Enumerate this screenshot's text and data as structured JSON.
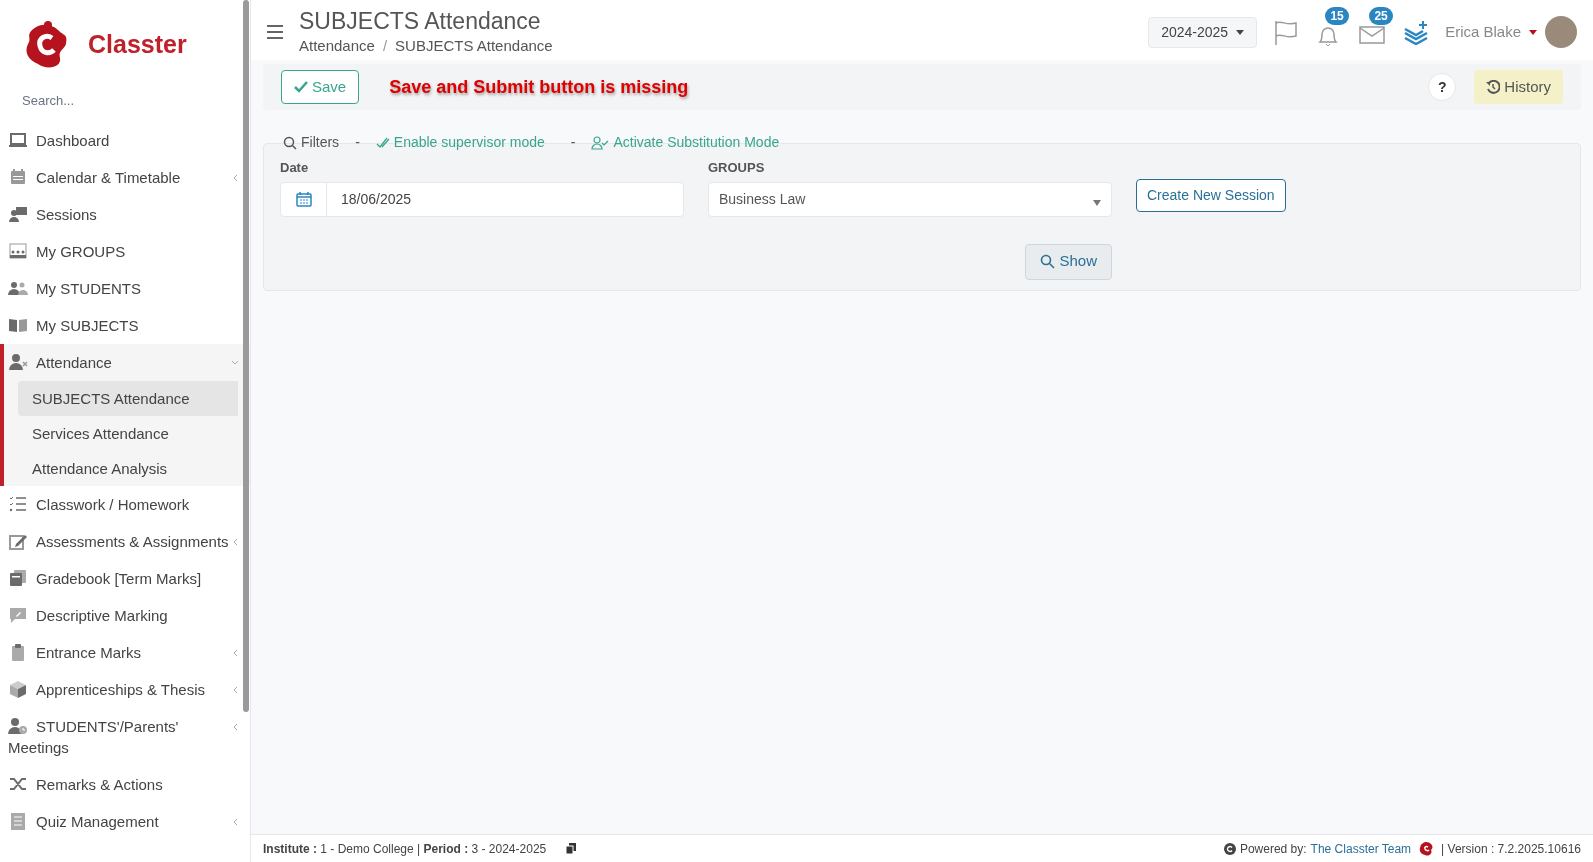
{
  "brand": {
    "name": "Classter"
  },
  "sidebar": {
    "search": {
      "placeholder": "Search..."
    },
    "items": [
      {
        "label": "Dashboard",
        "has_submenu": false,
        "expanded": false
      },
      {
        "label": "Calendar & Timetable",
        "has_submenu": true,
        "expanded": false
      },
      {
        "label": "Sessions",
        "has_submenu": false,
        "expanded": false
      },
      {
        "label": "My GROUPS",
        "has_submenu": false,
        "expanded": false
      },
      {
        "label": "My STUDENTS",
        "has_submenu": false,
        "expanded": false
      },
      {
        "label": "My SUBJECTS",
        "has_submenu": false,
        "expanded": false
      },
      {
        "label": "Attendance",
        "has_submenu": true,
        "expanded": true,
        "children": [
          {
            "label": "SUBJECTS Attendance",
            "selected": true
          },
          {
            "label": "Services Attendance",
            "selected": false
          },
          {
            "label": "Attendance Analysis",
            "selected": false
          }
        ]
      },
      {
        "label": "Classwork / Homework",
        "has_submenu": false,
        "expanded": false
      },
      {
        "label": "Assessments & Assignments",
        "has_submenu": true,
        "expanded": false
      },
      {
        "label": "Gradebook [Term Marks]",
        "has_submenu": false,
        "expanded": false
      },
      {
        "label": "Descriptive Marking",
        "has_submenu": false,
        "expanded": false
      },
      {
        "label": "Entrance Marks",
        "has_submenu": true,
        "expanded": false
      },
      {
        "label": "Apprenticeships & Thesis",
        "has_submenu": true,
        "expanded": false
      },
      {
        "label": "STUDENTS'/Parents' Meetings",
        "has_submenu": true,
        "expanded": false
      },
      {
        "label": "Remarks & Actions",
        "has_submenu": false,
        "expanded": false
      },
      {
        "label": "Quiz Management",
        "has_submenu": true,
        "expanded": false
      }
    ]
  },
  "header": {
    "title": "SUBJECTS Attendance",
    "breadcrumb": [
      "Attendance",
      "SUBJECTS Attendance"
    ],
    "breadcrumb_separator": "/",
    "year": "2024-2025",
    "notifications": "15",
    "messages": "25",
    "user": "Erica Blake"
  },
  "toolbar": {
    "save": "Save",
    "annotation": "Save and Submit button is missing",
    "help": "?",
    "history": "History"
  },
  "filters": {
    "title": "Filters",
    "separator": "-",
    "links": [
      "Enable supervisor mode",
      "Activate Substitution Mode"
    ],
    "date": {
      "label": "Date",
      "value": "18/06/2025"
    },
    "groups": {
      "label": "GROUPS",
      "value": "Business Law"
    },
    "create": "Create New Session",
    "show": "Show"
  },
  "footer": {
    "info": "**Institute :** 1 - Demo College | **Period :** 3 - 2024-2025",
    "powered": "Powered by:",
    "team": "The Classter Team",
    "version": "| Version : 7.2.2025.10616"
  }
}
